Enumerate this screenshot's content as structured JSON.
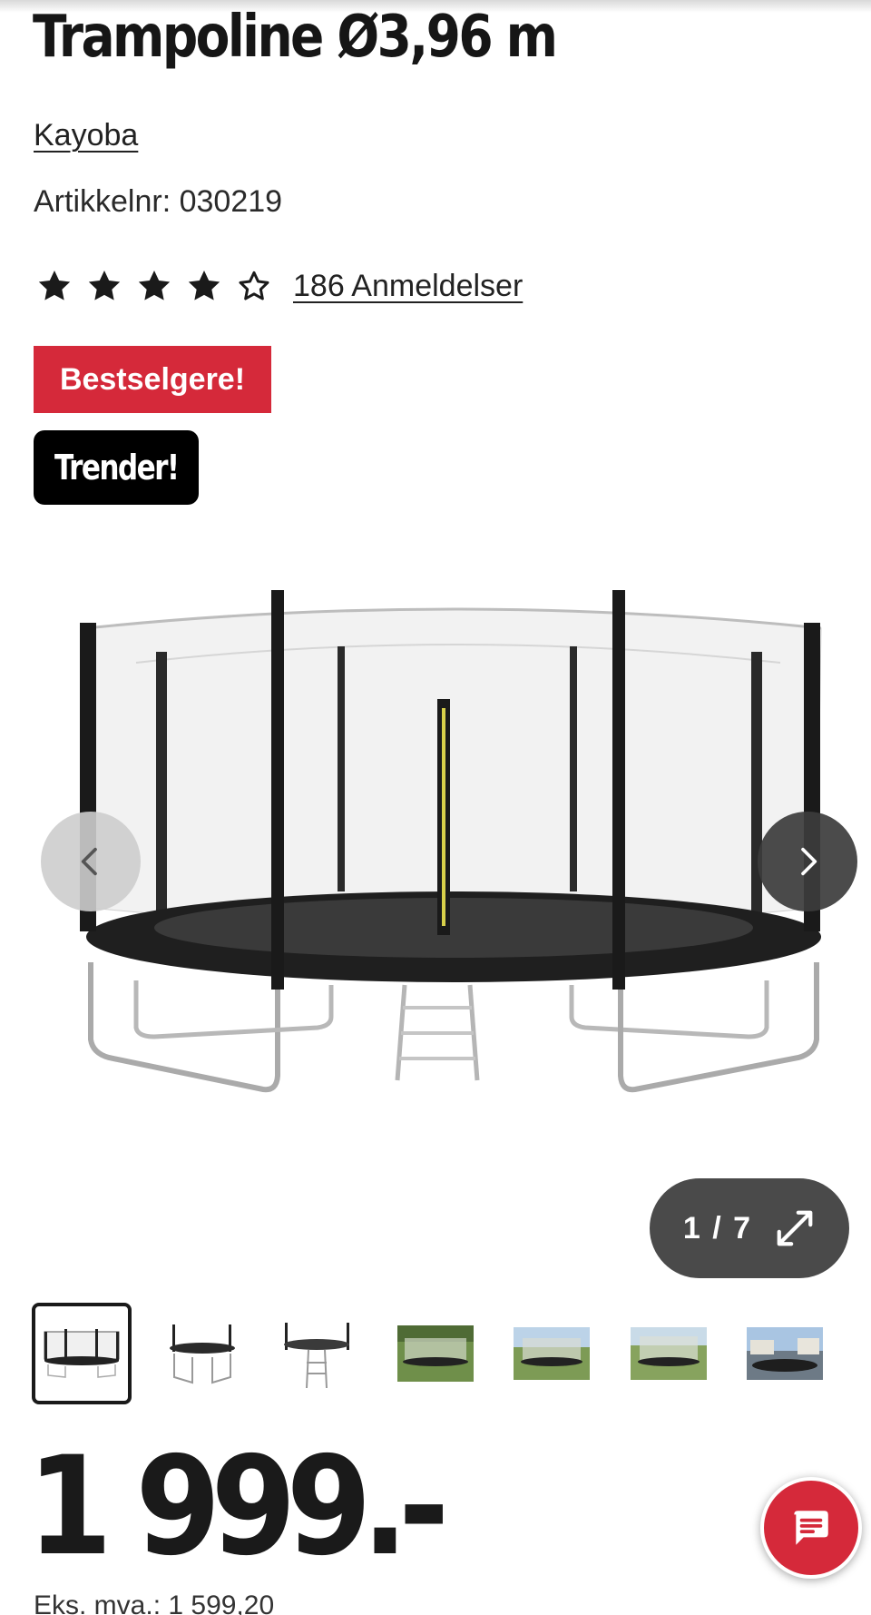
{
  "product": {
    "title": "Trampoline Ø3,96 m",
    "brand": "Kayoba",
    "sku": "Artikkelnr: 030219",
    "rating": {
      "value": 4,
      "max": 5,
      "reviews_label": "186 Anmeldelser"
    },
    "badges": {
      "bestseller": "Bestselgere!",
      "trending": "Trender!"
    }
  },
  "gallery": {
    "counter": "1 / 7",
    "current": 1,
    "total": 7,
    "thumbnails": [
      "thumb-1",
      "thumb-2",
      "thumb-3",
      "thumb-4",
      "thumb-5",
      "thumb-6",
      "thumb-7"
    ]
  },
  "pricing": {
    "price": "1 999.-",
    "ex_vat": "Eks. mva.: 1 599,20"
  },
  "icons": {
    "prev": "chevron-left-icon",
    "next": "chevron-right-icon",
    "expand": "expand-icon",
    "chat": "chat-icon",
    "star": "star-icon"
  },
  "colors": {
    "accent_red": "#d5293a",
    "badge_black": "#000000",
    "text": "#1a1a1a"
  }
}
